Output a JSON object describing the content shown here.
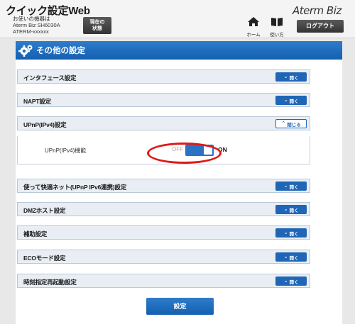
{
  "header": {
    "app_title": "クイック設定Web",
    "device_lines": [
      "お使いの機器は",
      "Aterm Biz SH6030A",
      "ATERM-xxxxxx"
    ],
    "status_button_lines": [
      "現在の",
      "状態"
    ],
    "brand": "Aterm Biz",
    "nav_home_label": "ホーム",
    "nav_manual_label": "使い方",
    "logout_label": "ログアウト"
  },
  "page": {
    "title": "その他の設定",
    "open_label": "開く",
    "close_label": "閉じる"
  },
  "sections": [
    {
      "label": "インタフェース設定",
      "state": "collapsed"
    },
    {
      "label": "NAPT設定",
      "state": "collapsed"
    },
    {
      "label": "UPnP(IPv4)設定",
      "state": "expanded"
    },
    {
      "label": "使って快適ネット(UPnP IPv6連携)設定",
      "state": "collapsed"
    },
    {
      "label": "DMZホスト設定",
      "state": "collapsed"
    },
    {
      "label": "補助設定",
      "state": "collapsed"
    },
    {
      "label": "ECOモード設定",
      "state": "collapsed"
    },
    {
      "label": "時刻指定再起動設定",
      "state": "collapsed"
    }
  ],
  "upnp": {
    "row_label": "UPnP(IPv4)機能",
    "toggle_off_label": "OFF",
    "toggle_on_label": "ON",
    "toggle_value": "ON"
  },
  "submit_label": "設定",
  "colors": {
    "accent": "#1f66b6",
    "highlight": "#e01818"
  },
  "icons": {
    "home": "home-icon",
    "manual": "book-icon",
    "settings": "gear-icon"
  }
}
